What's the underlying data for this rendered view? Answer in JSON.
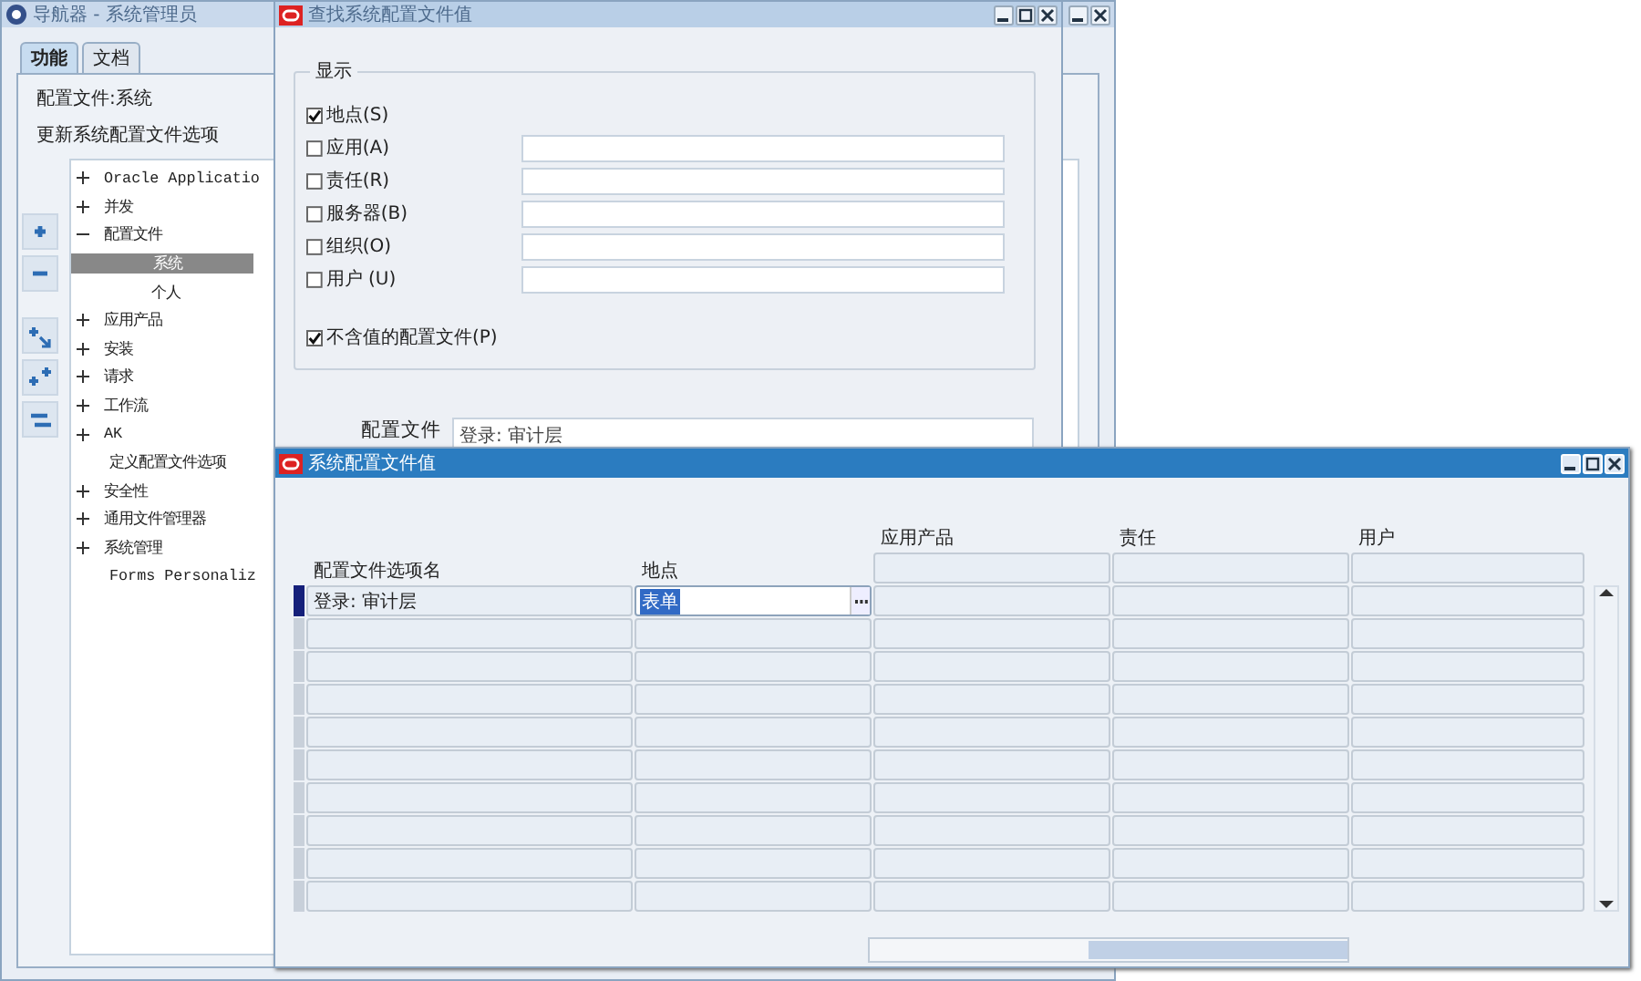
{
  "navigator": {
    "title": "导航器 - 系统管理员",
    "tabs": [
      {
        "label": "功能",
        "selected": true
      },
      {
        "label": "文档",
        "selected": false
      }
    ],
    "profile_label": "配置文件:系统",
    "heading": "更新系统配置文件选项",
    "tree": [
      {
        "label": "Oracle Applicatio",
        "kind": "folder",
        "expanded": false,
        "selected": false
      },
      {
        "label": "并发",
        "kind": "folder",
        "expanded": false,
        "selected": false
      },
      {
        "label": "配置文件",
        "kind": "folder",
        "expanded": true,
        "selected": false,
        "children": [
          {
            "label": "系统",
            "selected": true
          },
          {
            "label": "个人",
            "selected": false
          }
        ]
      },
      {
        "label": "应用产品",
        "kind": "folder",
        "expanded": false,
        "selected": false
      },
      {
        "label": "安装",
        "kind": "folder",
        "expanded": false,
        "selected": false
      },
      {
        "label": "请求",
        "kind": "folder",
        "expanded": false,
        "selected": false
      },
      {
        "label": "工作流",
        "kind": "folder",
        "expanded": false,
        "selected": false
      },
      {
        "label": "AK",
        "kind": "folder",
        "expanded": false,
        "selected": false
      },
      {
        "label": "定义配置文件选项",
        "kind": "leaf",
        "selected": false
      },
      {
        "label": "安全性",
        "kind": "folder",
        "expanded": false,
        "selected": false
      },
      {
        "label": "通用文件管理器",
        "kind": "folder",
        "expanded": false,
        "selected": false
      },
      {
        "label": "系统管理",
        "kind": "folder",
        "expanded": false,
        "selected": false
      },
      {
        "label": "Forms Personaliz",
        "kind": "leaf",
        "selected": false
      }
    ]
  },
  "find_window": {
    "title": "查找系统配置文件值",
    "group_title": "显示",
    "options": [
      {
        "label": "地点(S)",
        "checked": true,
        "kind": "plain"
      },
      {
        "label": "应用(A)",
        "checked": false,
        "kind": "with_field"
      },
      {
        "label": "责任(R)",
        "checked": false,
        "kind": "with_field"
      },
      {
        "label": "服务器(B)",
        "checked": false,
        "kind": "with_field"
      },
      {
        "label": "组织(O)",
        "checked": false,
        "kind": "with_field"
      },
      {
        "label": "用户 (U)",
        "checked": false,
        "kind": "with_field"
      }
    ],
    "no_value_option": {
      "label": "不含值的配置文件(P)",
      "checked": true
    },
    "profile_field": {
      "label": "配置文件",
      "value": "登录: 审计层"
    }
  },
  "values_window": {
    "title": "系统配置文件值",
    "columns": [
      "配置文件选项名",
      "地点",
      "应用产品",
      "责任",
      "用户"
    ],
    "rows": [
      {
        "name": "登录: 审计层",
        "site": "表单"
      }
    ]
  }
}
